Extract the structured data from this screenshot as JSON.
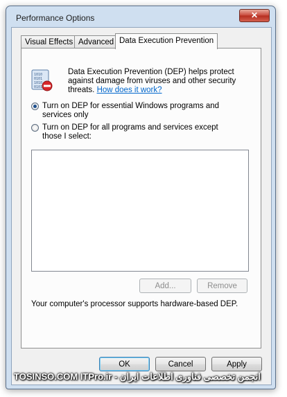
{
  "window": {
    "title": "Performance Options",
    "close_glyph": "✕"
  },
  "tabs": [
    {
      "label": "Visual Effects"
    },
    {
      "label": "Advanced"
    },
    {
      "label": "Data Execution Prevention"
    }
  ],
  "dep": {
    "description": "Data Execution Prevention (DEP) helps protect against damage from viruses and other security threats. ",
    "link": "How does it work?",
    "icon": "dep-shield-icon"
  },
  "options": [
    {
      "label": "Turn on DEP for essential Windows programs and services only",
      "checked": true
    },
    {
      "label": "Turn on DEP for all programs and services except those I select:",
      "checked": false
    }
  ],
  "list_buttons": {
    "add": "Add...",
    "remove": "Remove"
  },
  "status": "Your computer's processor supports hardware-based DEP.",
  "footer": {
    "ok": "OK",
    "cancel": "Cancel",
    "apply": "Apply"
  },
  "watermark": "TOSINSO.COM  ITPro.ir - انجمن تخصصی فناوری اطلاعات ایران",
  "colors": {
    "link": "#0066cc",
    "accent": "#3c7fb1"
  }
}
